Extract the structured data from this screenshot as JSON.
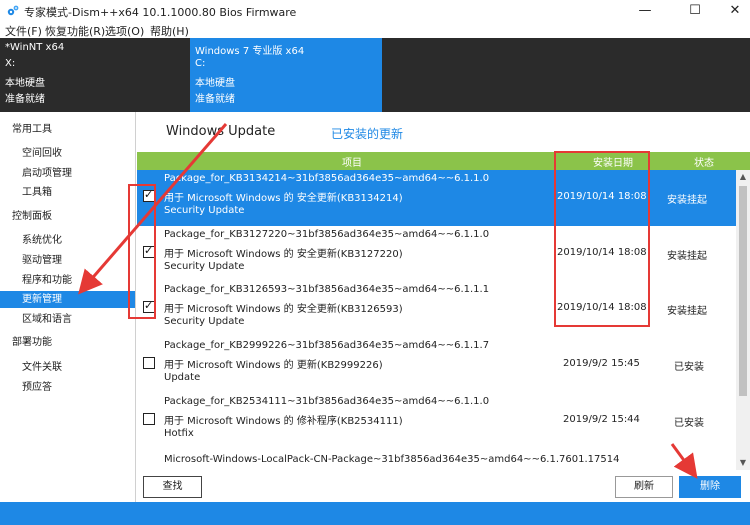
{
  "window": {
    "title": "专家模式-Dism++x64 10.1.1000.80 Bios Firmware",
    "min_glyph": "—",
    "max_glyph": "☐",
    "close_glyph": "✕",
    "icon": "gear-cluster-icon"
  },
  "menu": [
    "文件(F)",
    "恢复功能(R)",
    "选项(O)",
    "帮助(H)"
  ],
  "systems": [
    {
      "name": "*WinNT x64",
      "drive": "X:",
      "disk": "本地硬盘",
      "state": "准备就绪"
    },
    {
      "name": "Windows 7 专业版 x64",
      "drive": "C:",
      "disk": "本地硬盘",
      "state": "准备就绪"
    }
  ],
  "sidebar": {
    "groups": [
      {
        "label": "常用工具",
        "items": [
          "空间回收",
          "启动项管理",
          "工具箱"
        ]
      },
      {
        "label": "控制面板",
        "items": [
          "系统优化",
          "驱动管理",
          "程序和功能",
          "更新管理",
          "区域和语言"
        ]
      },
      {
        "label": "部署功能",
        "items": [
          "文件关联",
          "预应答"
        ]
      }
    ],
    "selected": "更新管理"
  },
  "tabs": {
    "windows_update": "Windows Update",
    "installed": "已安装的更新"
  },
  "table": {
    "headers": {
      "item": "项目",
      "date": "安装日期",
      "status": "状态"
    },
    "rows": [
      {
        "checked": true,
        "selected": true,
        "line1": "Package_for_KB3134214~31bf3856ad364e35~amd64~~6.1.1.0",
        "line2": "用于 Microsoft Windows 的 安全更新(KB3134214)",
        "line3": "Security Update",
        "date": "2019/10/14 18:08",
        "status": "安装挂起"
      },
      {
        "checked": true,
        "selected": false,
        "line1": "Package_for_KB3127220~31bf3856ad364e35~amd64~~6.1.1.0",
        "line2": "用于 Microsoft Windows 的 安全更新(KB3127220)",
        "line3": "Security Update",
        "date": "2019/10/14 18:08",
        "status": "安装挂起"
      },
      {
        "checked": true,
        "selected": false,
        "line1": "Package_for_KB3126593~31bf3856ad364e35~amd64~~6.1.1.1",
        "line2": "用于 Microsoft Windows 的 安全更新(KB3126593)",
        "line3": "Security Update",
        "date": "2019/10/14 18:08",
        "status": "安装挂起"
      },
      {
        "checked": false,
        "selected": false,
        "line1": "Package_for_KB2999226~31bf3856ad364e35~amd64~~6.1.1.7",
        "line2": "用于 Microsoft Windows 的 更新(KB2999226)",
        "line3": "Update",
        "date": "2019/9/2 15:45",
        "status": "已安装"
      },
      {
        "checked": false,
        "selected": false,
        "line1": "Package_for_KB2534111~31bf3856ad364e35~amd64~~6.1.1.0",
        "line2": "用于 Microsoft Windows 的 修补程序(KB2534111)",
        "line3": "Hotfix",
        "date": "2019/9/2 15:44",
        "status": "已安装"
      },
      {
        "checked": false,
        "selected": false,
        "line1": "Microsoft-Windows-LocalPack-CN-Package~31bf3856ad364e35~amd64~~6.1.7601.17514",
        "line2": "",
        "line3": "",
        "date": "",
        "status": ""
      }
    ]
  },
  "buttons": {
    "find": "查找",
    "refresh": "刷新",
    "delete": "删除"
  },
  "colors": {
    "accent": "#1e88e5",
    "header_green": "#8bc34a",
    "annotation_red": "#e53935",
    "dark_band": "#2b2b2b"
  }
}
